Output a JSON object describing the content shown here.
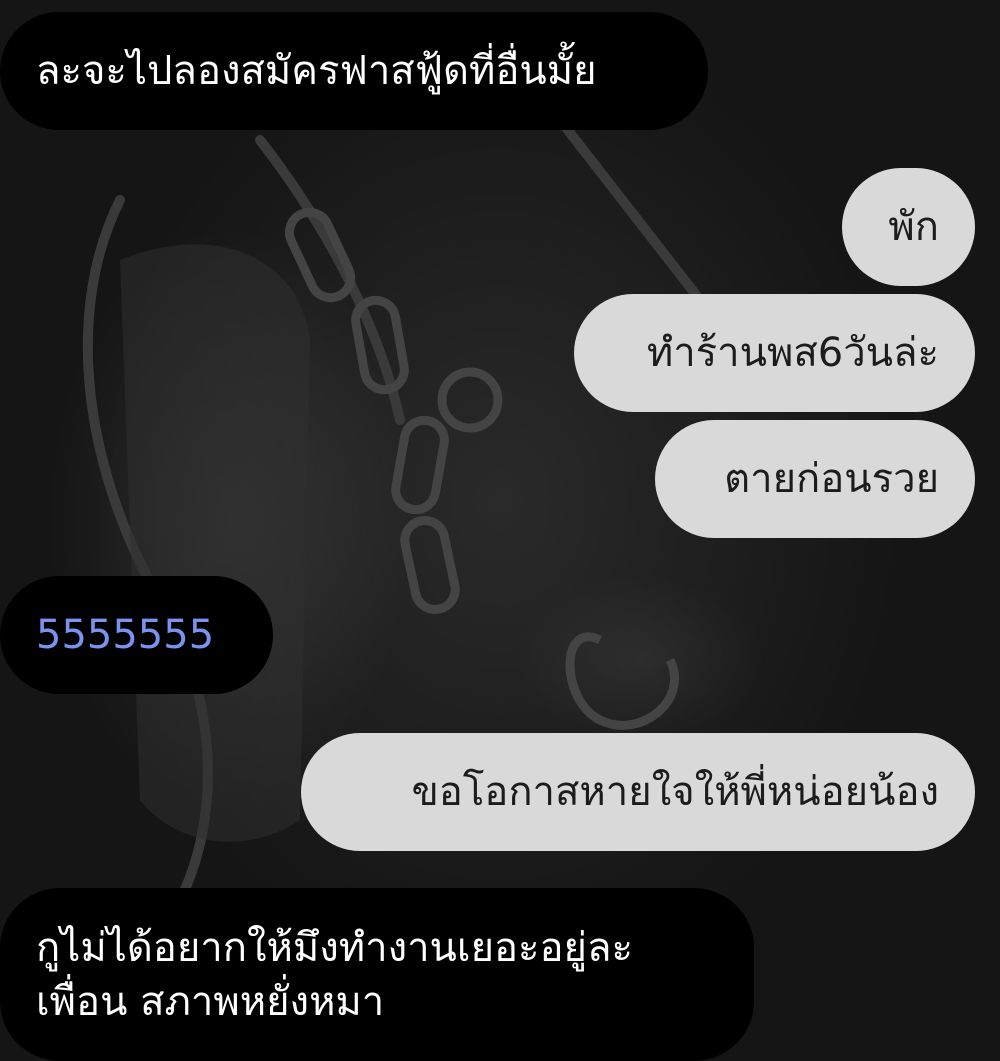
{
  "chat": {
    "messages": [
      {
        "side": "incoming",
        "text": "ละจะไปลองสมัครฟาสฟู้ดที่อื่นมั้ย"
      },
      {
        "side": "outgoing",
        "text": "พัก"
      },
      {
        "side": "outgoing",
        "text": "ทำร้านพส6วันล่ะ"
      },
      {
        "side": "outgoing",
        "text": "ตายก่อนรวย"
      },
      {
        "side": "incoming",
        "text": "5555555",
        "color": "#7b93f0"
      },
      {
        "side": "outgoing",
        "text": "ขอโอกาสหายใจให้พี่หน่อยน้อง"
      },
      {
        "side": "incoming",
        "lines": [
          "กูไม่ได้อยากให้มึงทำงานเยอะอยู่ละ",
          "เพื่อน สภาพหยั่งหมา"
        ]
      }
    ]
  },
  "colors": {
    "incoming_bubble": "#000000",
    "outgoing_bubble": "#d9d9d9",
    "link_text": "#7b93f0"
  }
}
